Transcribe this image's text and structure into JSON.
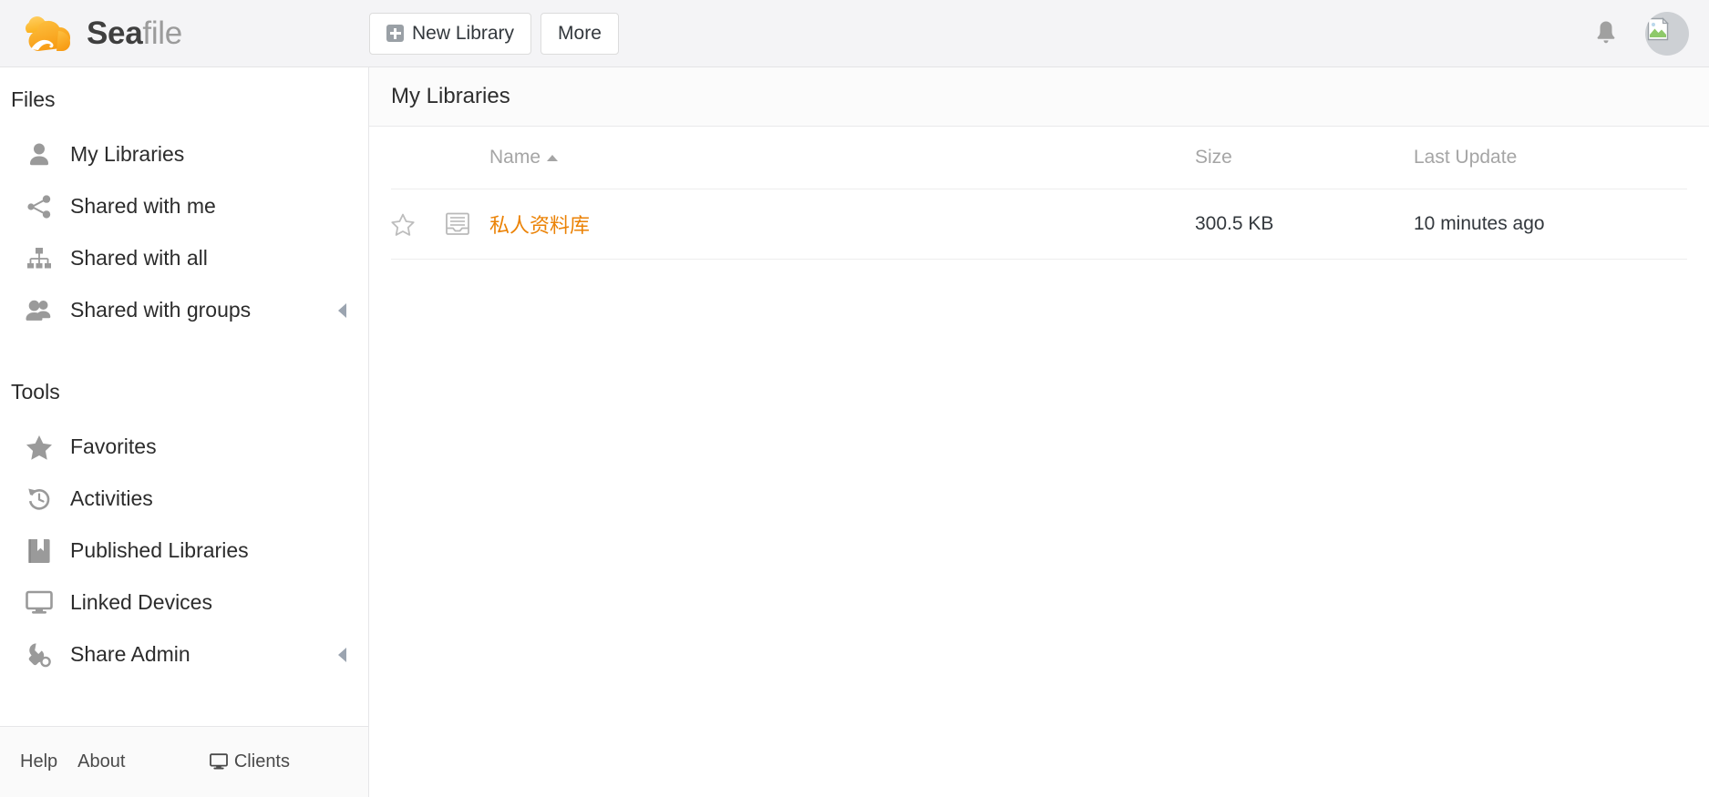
{
  "brand": {
    "name_bold": "Sea",
    "name_light": "file",
    "logo_icon": "seafile-cloud-logo",
    "accent_color": "#fbad2c"
  },
  "header": {
    "new_library_label": "New Library",
    "new_library_icon": "plus-square-icon",
    "more_label": "More",
    "notifications_icon": "bell-icon",
    "avatar_icon": "user-avatar"
  },
  "sidebar": {
    "sections": [
      {
        "title": "Files",
        "items": [
          {
            "label": "My Libraries",
            "icon": "user-icon",
            "arrow": false
          },
          {
            "label": "Shared with me",
            "icon": "share-nodes-icon",
            "arrow": false
          },
          {
            "label": "Shared with all",
            "icon": "sitemap-icon",
            "arrow": false
          },
          {
            "label": "Shared with groups",
            "icon": "users-icon",
            "arrow": true
          }
        ]
      },
      {
        "title": "Tools",
        "items": [
          {
            "label": "Favorites",
            "icon": "star-icon",
            "arrow": false
          },
          {
            "label": "Activities",
            "icon": "history-icon",
            "arrow": false
          },
          {
            "label": "Published Libraries",
            "icon": "book-icon",
            "arrow": false
          },
          {
            "label": "Linked Devices",
            "icon": "monitor-icon",
            "arrow": false
          },
          {
            "label": "Share Admin",
            "icon": "wrench-icon",
            "arrow": true
          }
        ]
      }
    ],
    "footer": {
      "help_label": "Help",
      "about_label": "About",
      "clients_label": "Clients",
      "clients_icon": "monitor-icon"
    }
  },
  "main": {
    "title": "My Libraries",
    "columns": {
      "name": "Name",
      "size": "Size",
      "last_update": "Last Update",
      "sort_direction_icon": "caret-up-icon"
    },
    "rows": [
      {
        "starred": false,
        "star_icon": "star-outline-icon",
        "library_icon": "library-icon",
        "name": "私人资料库",
        "size": "300.5 KB",
        "last_update": "10 minutes ago"
      }
    ]
  }
}
